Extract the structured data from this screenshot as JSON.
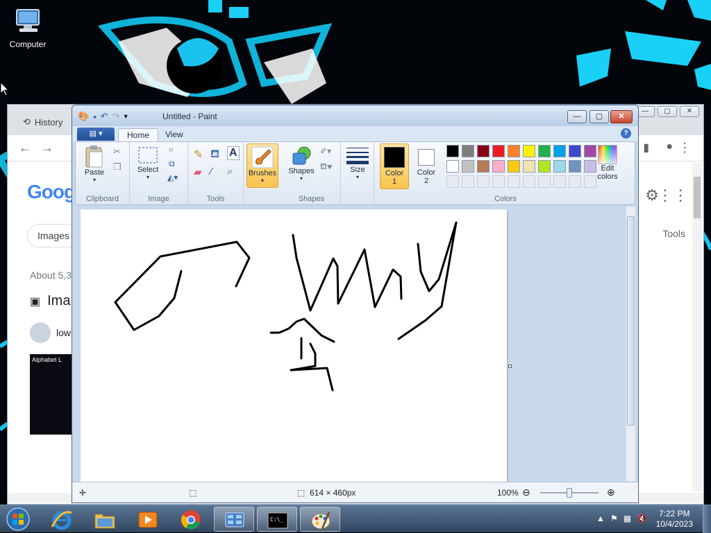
{
  "desktop": {
    "icon_label": "Computer"
  },
  "chrome": {
    "history_label": "History",
    "google_logo": "Goog",
    "chip_images": "Images",
    "about_text": "About 5,3",
    "images_heading": "Ima",
    "result_text": "low",
    "thumb_text": "Alphabet L",
    "tools_label": "Tools",
    "win_min": "—",
    "win_max": "▢",
    "win_close": "✕"
  },
  "paint": {
    "title": "Untitled - Paint",
    "file_menu": "▤ ▾",
    "tabs": [
      "Home",
      "View"
    ],
    "groups": {
      "clipboard": "Clipboard",
      "image": "Image",
      "tools": "Tools",
      "shapes": "Shapes",
      "colors": "Colors"
    },
    "buttons": {
      "paste": "Paste",
      "select": "Select",
      "brushes": "Brushes",
      "shapes": "Shapes",
      "size": "Size",
      "color1": "Color 1",
      "color2": "Color 2",
      "edit_colors": "Edit colors"
    },
    "color1": "#000000",
    "color2": "#ffffff",
    "palette_row1": [
      "#000000",
      "#7f7f7f",
      "#880015",
      "#ed1c24",
      "#ff7f27",
      "#fff200",
      "#22b14c",
      "#00a2e8",
      "#3f48cc",
      "#a349a4"
    ],
    "palette_row2": [
      "#ffffff",
      "#c3c3c3",
      "#b97a57",
      "#ffaec9",
      "#ffc90e",
      "#efe4b0",
      "#b5e61d",
      "#99d9ea",
      "#7092be",
      "#c8bfe7"
    ],
    "status": {
      "canvas_size": "614 × 460px",
      "zoom": "100%"
    }
  },
  "taskbar": {
    "time": "7:22 PM",
    "date": "10/4/2023"
  }
}
